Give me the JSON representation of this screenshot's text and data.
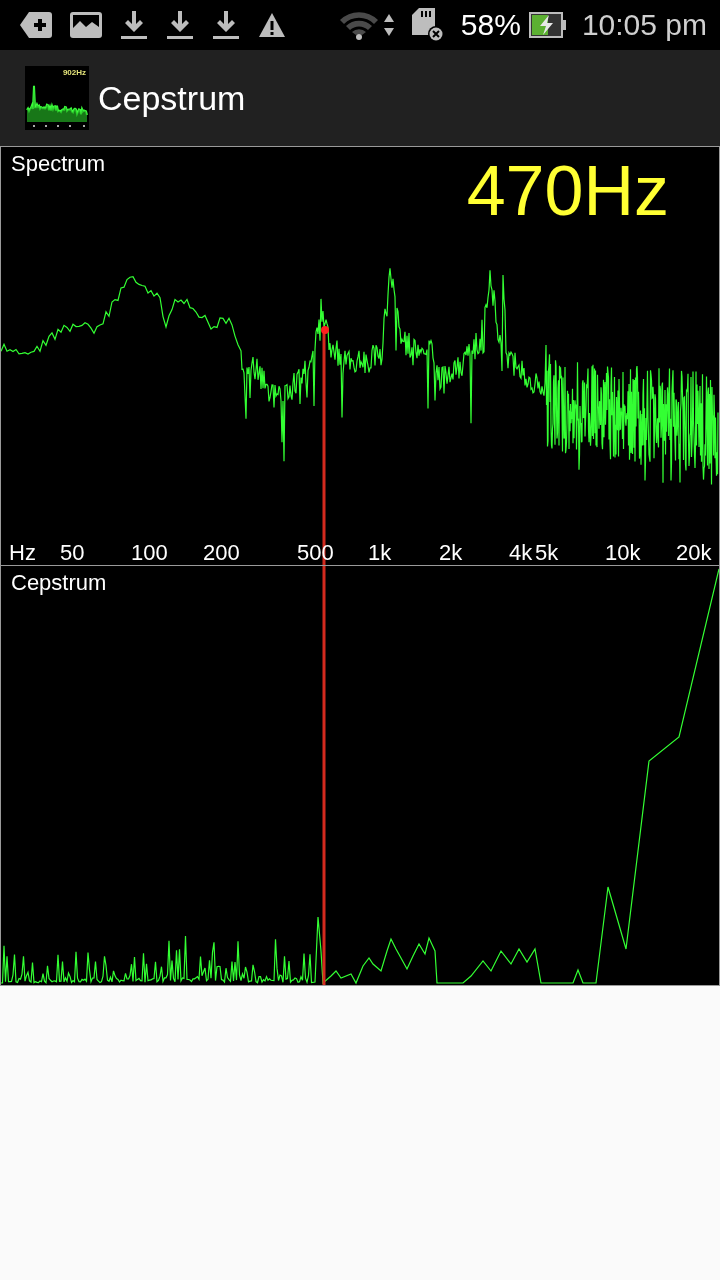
{
  "status_bar": {
    "battery_percent": "58%",
    "time": "10:05 pm"
  },
  "app_bar": {
    "icon_label": "902Hz",
    "title": "Cepstrum"
  },
  "spectrum": {
    "title": "Spectrum",
    "peak_frequency": "470Hz",
    "axis_labels": [
      "Hz",
      "50",
      "100",
      "200",
      "500",
      "1k",
      "2k",
      "4k",
      "5k",
      "10k",
      "20k"
    ]
  },
  "cepstrum": {
    "title": "Cepstrum"
  }
}
